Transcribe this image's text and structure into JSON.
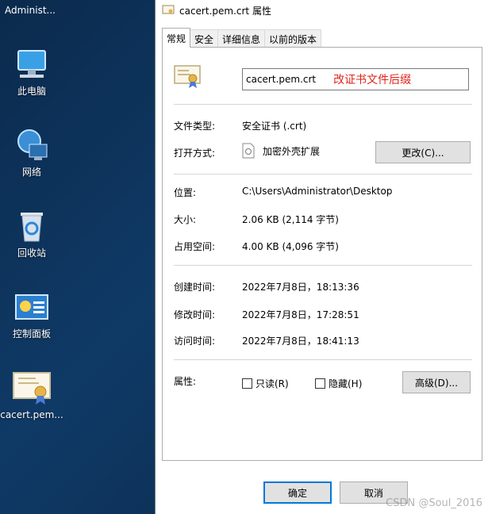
{
  "desktop": {
    "title": "Administ...",
    "icons": [
      {
        "label": "此电脑"
      },
      {
        "label": "网络"
      },
      {
        "label": "回收站"
      },
      {
        "label": "控制面板"
      },
      {
        "label": "cacert.pem..."
      }
    ]
  },
  "dialog": {
    "title": "cacert.pem.crt 属性",
    "tabs": [
      "常规",
      "安全",
      "详细信息",
      "以前的版本"
    ],
    "filename": "cacert.pem.crt",
    "hint": "改证书文件后缀",
    "fields": {
      "type_label": "文件类型:",
      "type_value": "安全证书 (.crt)",
      "open_label": "打开方式:",
      "open_value": "加密外壳扩展",
      "change_button": "更改(C)...",
      "location_label": "位置:",
      "location_value": "C:\\Users\\Administrator\\Desktop",
      "size_label": "大小:",
      "size_value": "2.06 KB (2,114 字节)",
      "disk_label": "占用空间:",
      "disk_value": "4.00 KB (4,096 字节)",
      "created_label": "创建时间:",
      "created_value": "2022年7月8日，18:13:36",
      "modified_label": "修改时间:",
      "modified_value": "2022年7月8日，17:28:51",
      "accessed_label": "访问时间:",
      "accessed_value": "2022年7月8日，18:41:13",
      "attr_label": "属性:",
      "readonly_label": "只读(R)",
      "hidden_label": "隐藏(H)",
      "advanced_button": "高级(D)..."
    },
    "ok_button": "确定",
    "cancel_button": "取消",
    "watermark": "CSDN @Soul_2016"
  }
}
